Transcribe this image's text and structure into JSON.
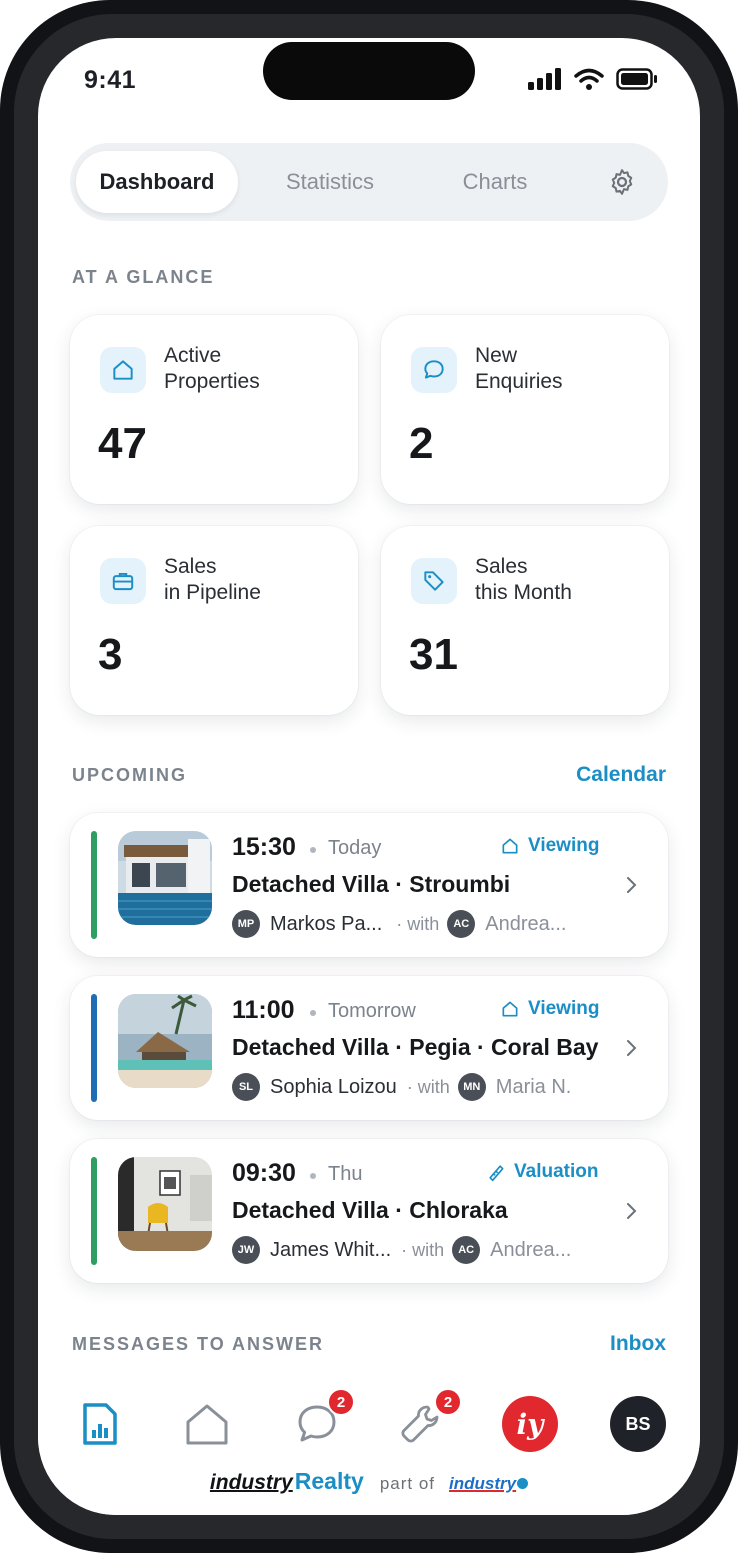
{
  "status_bar": {
    "time": "9:41"
  },
  "tabs": [
    {
      "label": "Dashboard",
      "active": true
    },
    {
      "label": "Statistics",
      "active": false
    },
    {
      "label": "Charts",
      "active": false
    }
  ],
  "at_a_glance": {
    "label": "AT A GLANCE",
    "cards": [
      {
        "icon": "house-icon",
        "label": "Active\nProperties",
        "value": "47"
      },
      {
        "icon": "chat-bubble-icon",
        "label": "New\nEnquiries",
        "value": "2"
      },
      {
        "icon": "briefcase-icon",
        "label": "Sales\nin Pipeline",
        "value": "3"
      },
      {
        "icon": "tag-icon",
        "label": "Sales\nthis Month",
        "value": "31"
      }
    ]
  },
  "upcoming": {
    "label": "UPCOMING",
    "link": "Calendar",
    "items": [
      {
        "time": "15:30",
        "day": "Today",
        "type": "Viewing",
        "type_icon": "house-icon",
        "title": "Detached Villa · Stroumbi",
        "agent_initials": "MP",
        "agent": "Markos Pa...",
        "with": "· with",
        "client_initials": "AC",
        "client": "Andrea...",
        "bar_color": "#2e9e63"
      },
      {
        "time": "11:00",
        "day": "Tomorrow",
        "type": "Viewing",
        "type_icon": "house-icon",
        "title": "Detached Villa · Pegia · Coral Bay",
        "agent_initials": "SL",
        "agent": "Sophia Loizou",
        "with": "· with",
        "client_initials": "MN",
        "client": "Maria N.",
        "bar_color": "#1f6db3"
      },
      {
        "time": "09:30",
        "day": "Thu",
        "type": "Valuation",
        "type_icon": "ruler-pencil-icon",
        "title": "Detached Villa · Chloraka",
        "agent_initials": "JW",
        "agent": "James Whit...",
        "with": "· with",
        "client_initials": "AC",
        "client": "Andrea...",
        "bar_color": "#2e9e63"
      }
    ]
  },
  "messages": {
    "label": "MESSAGES TO ANSWER",
    "link": "Inbox"
  },
  "nav": {
    "items": [
      {
        "icon": "report-icon",
        "active": true
      },
      {
        "icon": "house-icon"
      },
      {
        "icon": "chat-bubble-icon",
        "badge": "2"
      },
      {
        "icon": "wrench-icon",
        "badge": "2"
      },
      {
        "icon": "industry-logo-icon",
        "text": "iy"
      },
      {
        "icon": "profile-avatar",
        "text": "BS"
      }
    ]
  },
  "footer": {
    "brand_a": "industry",
    "brand_b": "Realty",
    "part_of": "part of",
    "brand_c": "industry"
  },
  "colors": {
    "accent": "#1b8ec6",
    "badge": "#e0282e",
    "green_bar": "#2e9e63",
    "blue_bar": "#1f6db3"
  }
}
